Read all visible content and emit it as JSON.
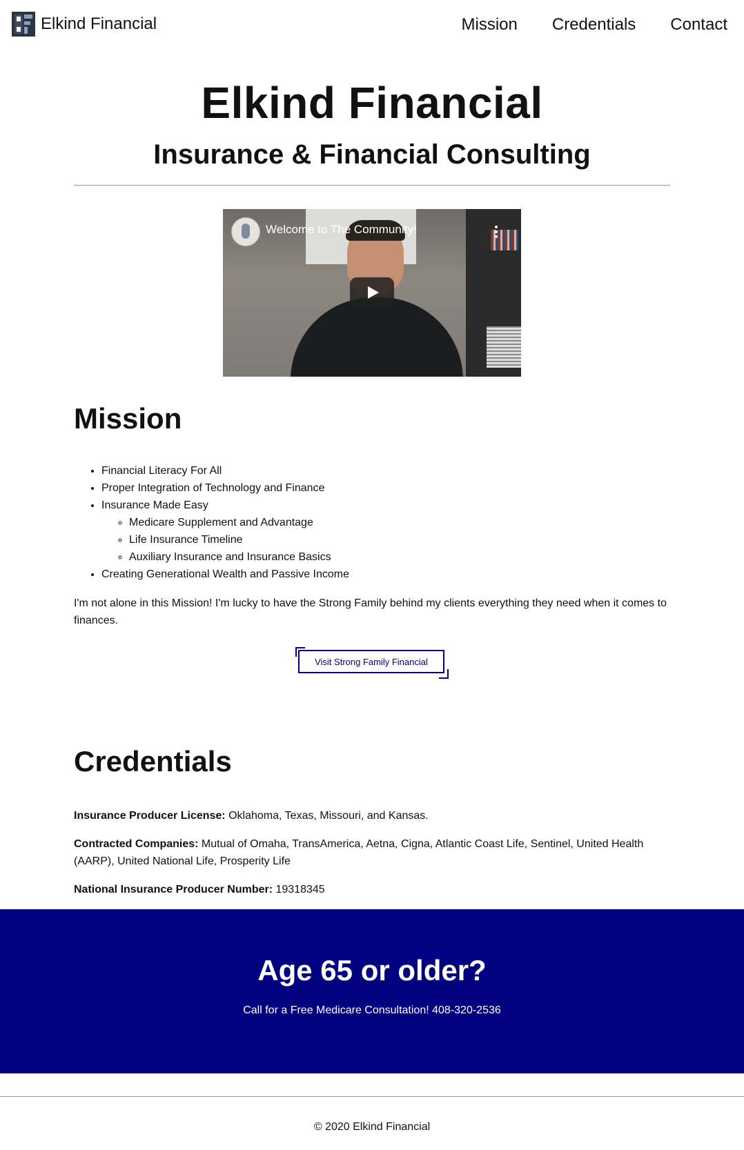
{
  "header": {
    "logo_text": "Elkind Financial",
    "nav": [
      "Mission",
      "Credentials",
      "Contact"
    ]
  },
  "hero": {
    "title": "Elkind Financial",
    "subtitle": "Insurance & Financial Consulting"
  },
  "video": {
    "title": "Welcome to The Community!",
    "icons": [
      "channel-avatar-icon",
      "more-options-icon",
      "play-icon"
    ]
  },
  "mission": {
    "heading": "Mission",
    "items": [
      "Financial Literacy For All",
      "Proper Integration of Technology and Finance",
      "Insurance Made Easy",
      "Creating Generational Wealth and Passive Income"
    ],
    "subitems": [
      "Medicare Supplement and Advantage",
      "Life Insurance Timeline",
      "Auxiliary Insurance and Insurance Basics"
    ],
    "paragraph": "I'm not alone in this Mission! I'm lucky to have the Strong Family behind my clients everything they need when it comes to finances.",
    "cta_label": "Visit Strong Family Financial"
  },
  "credentials": {
    "heading": "Credentials",
    "license_label": "Insurance Producer License:",
    "license_value": " Oklahoma, Texas, Missouri, and Kansas.",
    "companies_label": "Contracted Companies:",
    "companies_value": " Mutual of Omaha, TransAmerica, Aetna, Cigna, Atlantic Coast Life, Sentinel, United Health (AARP), United National Life, Prosperity Life",
    "npn_label": "National Insurance Producer Number:",
    "npn_value": " 19318345"
  },
  "banner": {
    "heading": "Age 65 or older?",
    "text": "Call for a Free Medicare Consultation! 408-320-2536"
  },
  "footer": {
    "copyright": "© 2020 Elkind Financial"
  },
  "colors": {
    "accent": "#000080",
    "text": "#111111",
    "background": "#ffffff"
  }
}
